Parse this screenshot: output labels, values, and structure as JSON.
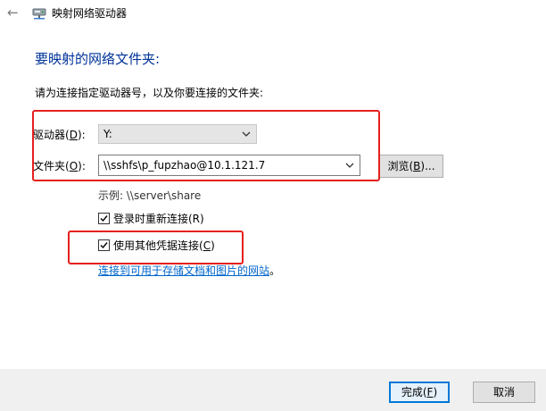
{
  "window": {
    "title": "映射网络驱动器",
    "back_icon": "back-arrow-icon",
    "app_icon": "network-drive-icon"
  },
  "heading": "要映射的网络文件夹:",
  "instruction": "请为连接指定驱动器号，以及你要连接的文件夹:",
  "drive": {
    "label": "驱动器(",
    "label_key": "D",
    "label_end": "):",
    "value": "Y:"
  },
  "folder": {
    "label": "文件夹(",
    "label_key": "O",
    "label_end": "):",
    "value": "\\\\sshfs\\p_fupzhao@10.1.121.7",
    "browse": {
      "label": "浏览(",
      "label_key": "B",
      "label_end": ")..."
    }
  },
  "example": "示例: \\\\server\\share",
  "options": {
    "reconnect": {
      "label": "登录时重新连接(R)",
      "checked": true
    },
    "other_credentials": {
      "label": "使用其他凭据连接(",
      "label_key": "C",
      "label_end": ")",
      "checked": true
    }
  },
  "link": "连接到可用于存储文档和图片的网站",
  "link_suffix": "。",
  "buttons": {
    "finish": {
      "label": "完成(",
      "label_key": "F",
      "label_end": ")"
    },
    "cancel": "取消"
  },
  "colors": {
    "heading": "#003399",
    "link": "#0066cc",
    "highlight": "#e5201d",
    "primary_border": "#0078d7"
  }
}
